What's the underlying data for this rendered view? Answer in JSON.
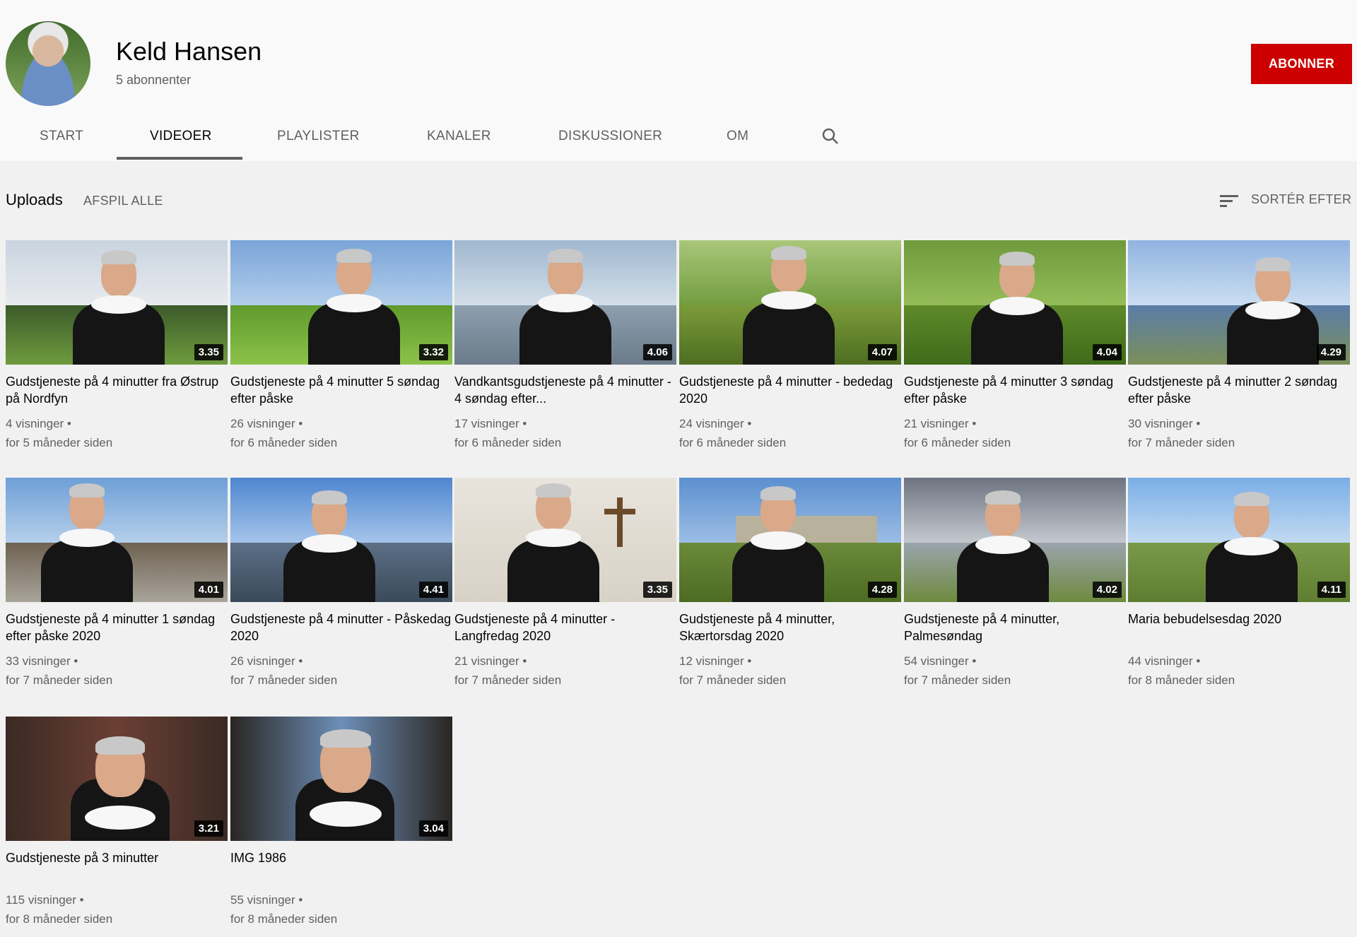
{
  "channel": {
    "name": "Keld Hansen",
    "subscribers": "5 abonnenter",
    "subscribe_label": "ABONNER"
  },
  "tabs": [
    {
      "label": "START"
    },
    {
      "label": "VIDEOER"
    },
    {
      "label": "PLAYLISTER"
    },
    {
      "label": "KANALER"
    },
    {
      "label": "DISKUSSIONER"
    },
    {
      "label": "OM"
    }
  ],
  "toolbar": {
    "uploads_label": "Uploads",
    "play_all_label": "AFSPIL ALLE",
    "sort_label": "SORTÉR EFTER"
  },
  "videos": [
    {
      "title": "Gudstjeneste på 4 minutter fra Østrup på Nordfyn",
      "duration": "3.35",
      "views": "4 visninger •",
      "age": "for 5 måneder siden"
    },
    {
      "title": "Gudstjeneste på 4 minutter 5 søndag efter påske",
      "duration": "3.32",
      "views": "26 visninger •",
      "age": "for 6 måneder siden"
    },
    {
      "title": "Vandkantsgudstjeneste på 4 minutter - 4 søndag efter...",
      "duration": "4.06",
      "views": "17 visninger •",
      "age": "for 6 måneder siden"
    },
    {
      "title": "Gudstjeneste på 4 minutter - bededag 2020",
      "duration": "4.07",
      "views": "24 visninger •",
      "age": "for 6 måneder siden"
    },
    {
      "title": "Gudstjeneste på 4 minutter 3 søndag efter påske",
      "duration": "4.04",
      "views": "21 visninger •",
      "age": "for 6 måneder siden"
    },
    {
      "title": "Gudstjeneste på 4 minutter 2 søndag efter påske",
      "duration": "4.29",
      "views": "30 visninger •",
      "age": "for 7 måneder siden"
    },
    {
      "title": "Gudstjeneste på 4 minutter 1 søndag efter påske 2020",
      "duration": "4.01",
      "views": "33 visninger •",
      "age": "for 7 måneder siden"
    },
    {
      "title": "Gudstjeneste på 4 minutter - Påskedag 2020",
      "duration": "4.41",
      "views": "26 visninger •",
      "age": "for 7 måneder siden"
    },
    {
      "title": "Gudstjeneste på 4 minutter - Langfredag 2020",
      "duration": "3.35",
      "views": "21 visninger •",
      "age": "for 7 måneder siden"
    },
    {
      "title": "Gudstjeneste på 4 minutter, Skærtorsdag 2020",
      "duration": "4.28",
      "views": "12 visninger •",
      "age": "for 7 måneder siden"
    },
    {
      "title": "Gudstjeneste på 4 minutter, Palmesøndag",
      "duration": "4.02",
      "views": "54 visninger •",
      "age": "for 7 måneder siden"
    },
    {
      "title": "Maria bebudelsesdag 2020",
      "duration": "4.11",
      "views": "44 visninger •",
      "age": "for 8 måneder siden"
    },
    {
      "title": "Gudstjeneste på 3 minutter",
      "duration": "3.21",
      "views": "115 visninger •",
      "age": "for 8 måneder siden"
    },
    {
      "title": "IMG 1986",
      "duration": "3.04",
      "views": "55 visninger •",
      "age": "for 8 måneder siden"
    }
  ],
  "colors": {
    "subscribe": "#cc0000",
    "header_bg": "#f9f9f9",
    "page_bg": "#f1f1f1"
  },
  "icons": [
    "search-icon",
    "sort-icon"
  ]
}
